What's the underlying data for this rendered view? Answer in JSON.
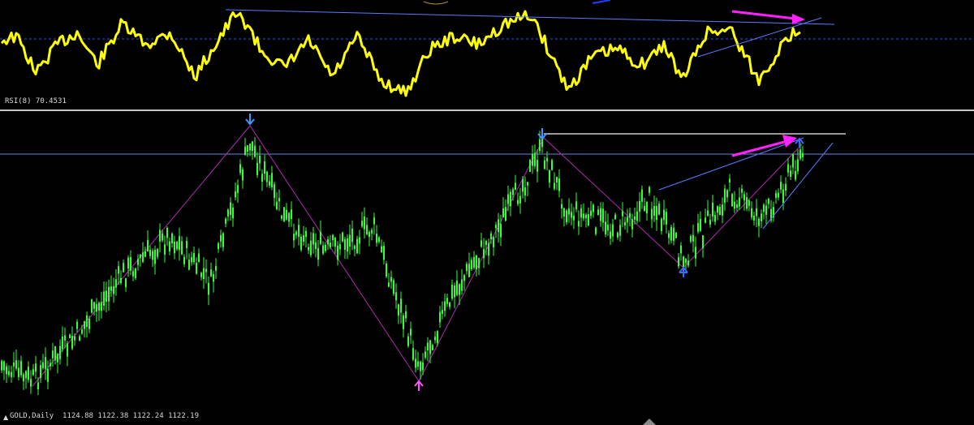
{
  "indicator": {
    "label": "RSI(8) 70.4531"
  },
  "symbol": {
    "label": "GOLD,Daily  1124.88 1122.38 1122.24 1122.19",
    "icon": "triangle-up-icon"
  },
  "colors": {
    "background": "#000000",
    "candle": "#33ff33",
    "rsi_line": "#ffff00",
    "trendline": "#5a7cff",
    "zigzag": "#b02ab0",
    "divergence_arrow": "#ff22ff",
    "top_arrow": "#3a9aff",
    "bottom_arrow": "#ff55ff",
    "horizontal_level": "#9a9a9a",
    "separator": "#c8c8c8"
  },
  "arrows": [
    {
      "name": "top-arrow-1",
      "icon": "arrow-down-icon"
    },
    {
      "name": "bottom-arrow-1",
      "icon": "arrow-up-icon"
    },
    {
      "name": "top-arrow-2",
      "icon": "arrow-down-icon"
    },
    {
      "name": "bottom-arrow-2",
      "icon": "arrow-up-icon"
    },
    {
      "name": "top-arrow-3",
      "icon": "arrow-up-icon"
    }
  ]
}
